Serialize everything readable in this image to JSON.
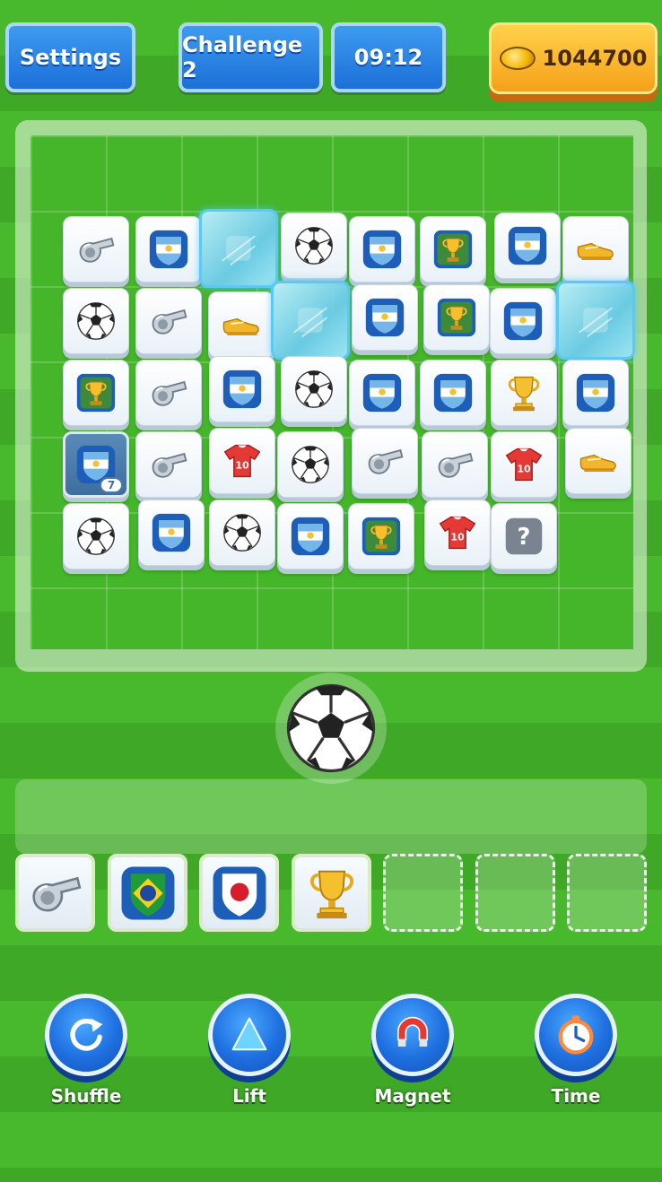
{
  "header": {
    "settings_label": "Settings",
    "level_label": "Challenge 2",
    "timer": "09:12",
    "coins": "1044700"
  },
  "board": {
    "tiles": [
      {
        "icon": "whistle-icon"
      },
      {
        "icon": "argentina-shield-icon"
      },
      {
        "icon": "frozen-tile-icon"
      },
      {
        "icon": "soccer-ball-icon"
      },
      {
        "icon": "argentina-shield-icon"
      },
      {
        "icon": "trophy-card-icon"
      },
      {
        "icon": "argentina-shield-icon"
      },
      {
        "icon": "golden-boot-icon"
      },
      {
        "icon": "soccer-ball-icon"
      },
      {
        "icon": "whistle-icon"
      },
      {
        "icon": "golden-boot-icon"
      },
      {
        "icon": "frozen-tile-icon"
      },
      {
        "icon": "argentina-shield-icon"
      },
      {
        "icon": "trophy-card-icon"
      },
      {
        "icon": "argentina-shield-icon"
      },
      {
        "icon": "frozen-tile-icon"
      },
      {
        "icon": "trophy-card-icon"
      },
      {
        "icon": "whistle-icon"
      },
      {
        "icon": "argentina-shield-icon"
      },
      {
        "icon": "soccer-ball-icon"
      },
      {
        "icon": "argentina-shield-icon"
      },
      {
        "icon": "argentina-shield-icon"
      },
      {
        "icon": "gold-trophy-icon"
      },
      {
        "icon": "argentina-shield-icon"
      },
      {
        "icon": "argentina-shield-icon"
      },
      {
        "icon": "whistle-icon"
      },
      {
        "icon": "red-jersey-icon"
      },
      {
        "icon": "soccer-ball-icon"
      },
      {
        "icon": "whistle-icon"
      },
      {
        "icon": "whistle-icon"
      },
      {
        "icon": "red-jersey-icon"
      },
      {
        "icon": "golden-boot-icon"
      },
      {
        "icon": "soccer-ball-icon"
      },
      {
        "icon": "argentina-shield-icon"
      },
      {
        "icon": "soccer-ball-icon"
      },
      {
        "icon": "argentina-shield-icon"
      },
      {
        "icon": "trophy-card-icon"
      },
      {
        "icon": "red-jersey-icon"
      },
      {
        "icon": "mystery-question-icon"
      }
    ],
    "stack_count": "7"
  },
  "slots": [
    {
      "icon": "whistle-icon"
    },
    {
      "icon": "brazil-shield-icon"
    },
    {
      "icon": "japan-shield-icon"
    },
    {
      "icon": "gold-trophy-icon"
    },
    {
      "icon": ""
    },
    {
      "icon": ""
    },
    {
      "icon": ""
    }
  ],
  "powerups": {
    "shuffle_label": "Shuffle",
    "lift_label": "Lift",
    "magnet_label": "Magnet",
    "time_label": "Time"
  },
  "colors": {
    "button_blue": "#1c6fd8",
    "coin_gold": "#f6a019",
    "field_green": "#45b52a",
    "ice_blue": "#6ecdf5"
  }
}
